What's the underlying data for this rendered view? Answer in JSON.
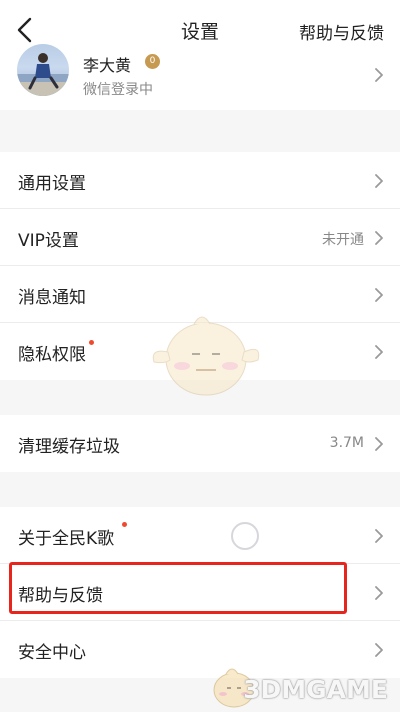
{
  "header": {
    "title": "设置",
    "help_link": "帮助与反馈"
  },
  "profile": {
    "name": "李大黄",
    "badge": "0",
    "login_status": "微信登录中"
  },
  "groups": [
    {
      "items": [
        {
          "label": "通用设置",
          "value": ""
        },
        {
          "label": "VIP设置",
          "value": "未开通"
        },
        {
          "label": "消息通知",
          "value": ""
        },
        {
          "label": "隐私权限",
          "value": "",
          "red_dot": true
        }
      ]
    },
    {
      "items": [
        {
          "label": "清理缓存垃圾",
          "value": "3.7M"
        }
      ]
    },
    {
      "items": [
        {
          "label": "关于全民K歌",
          "value": "",
          "red_dot": true
        },
        {
          "label": "帮助与反馈",
          "value": "",
          "highlighted": true
        },
        {
          "label": "安全中心",
          "value": ""
        }
      ]
    }
  ],
  "watermark": "3DMGAME",
  "colors": {
    "highlight": "#e8251c",
    "red_dot": "#f04a2e",
    "badge": "#c79a52"
  }
}
